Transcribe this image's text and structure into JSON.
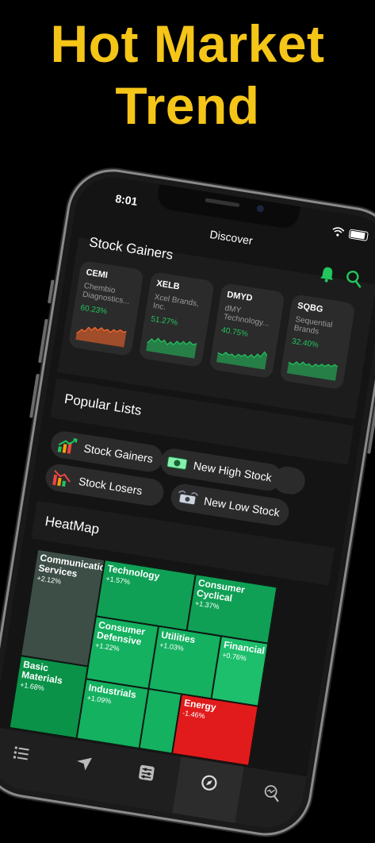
{
  "headline": {
    "line1": "Hot Market",
    "line2": "Trend",
    "color": "#f5c518"
  },
  "status_bar": {
    "time": "8:01"
  },
  "nav": {
    "title": "Discover",
    "bell_icon": "bell-icon",
    "search_icon": "search-icon"
  },
  "gainers": {
    "title": "Stock Gainers",
    "cards": [
      {
        "symbol": "CEMI",
        "name": "Chembio Diagnostics...",
        "change": "60.23%",
        "spark_color": "#ff6a2a"
      },
      {
        "symbol": "XELB",
        "name": "Xcel Brands, Inc.",
        "change": "51.27%",
        "spark_color": "#22c55e"
      },
      {
        "symbol": "DMYD",
        "name": "dMY Technology...",
        "change": "40.75%",
        "spark_color": "#22c55e"
      },
      {
        "symbol": "SQBG",
        "name": "Sequential Brands",
        "change": "32.40%",
        "spark_color": "#22c55e"
      }
    ]
  },
  "popular_lists": {
    "title": "Popular Lists",
    "chips": [
      {
        "label": "Stock Gainers",
        "icon": "chart-up-icon"
      },
      {
        "label": "New High Stock",
        "icon": "money-icon"
      },
      {
        "label": "Stock Losers",
        "icon": "chart-down-icon"
      },
      {
        "label": "New Low Stock",
        "icon": "money-fly-icon"
      }
    ]
  },
  "heatmap": {
    "title": "HeatMap",
    "sectors": [
      {
        "name": "Communication Services",
        "change": "+2.12%",
        "color": "#3d4e47"
      },
      {
        "name": "Technology",
        "change": "+1.57%",
        "color": "#0fa055"
      },
      {
        "name": "Consumer Cyclical",
        "change": "+1.37%",
        "color": "#0fa055"
      },
      {
        "name": "Consumer Defensive",
        "change": "+1.22%",
        "color": "#14b160"
      },
      {
        "name": "Utilities",
        "change": "+1.03%",
        "color": "#14b160"
      },
      {
        "name": "Financial",
        "change": "+0.76%",
        "color": "#1dbf6c"
      },
      {
        "name": "Basic Materials",
        "change": "+1.68%",
        "color": "#0a9248"
      },
      {
        "name": "Industrials",
        "change": "+1.09%",
        "color": "#14b160"
      },
      {
        "name": "Energy",
        "change": "-1.46%",
        "color": "#e11b1b"
      }
    ]
  },
  "tabbar": {
    "tabs": [
      {
        "icon": "list-icon"
      },
      {
        "icon": "send-icon"
      },
      {
        "icon": "sliders-icon"
      },
      {
        "icon": "compass-icon",
        "active": true
      },
      {
        "icon": "search-chart-icon"
      }
    ]
  }
}
